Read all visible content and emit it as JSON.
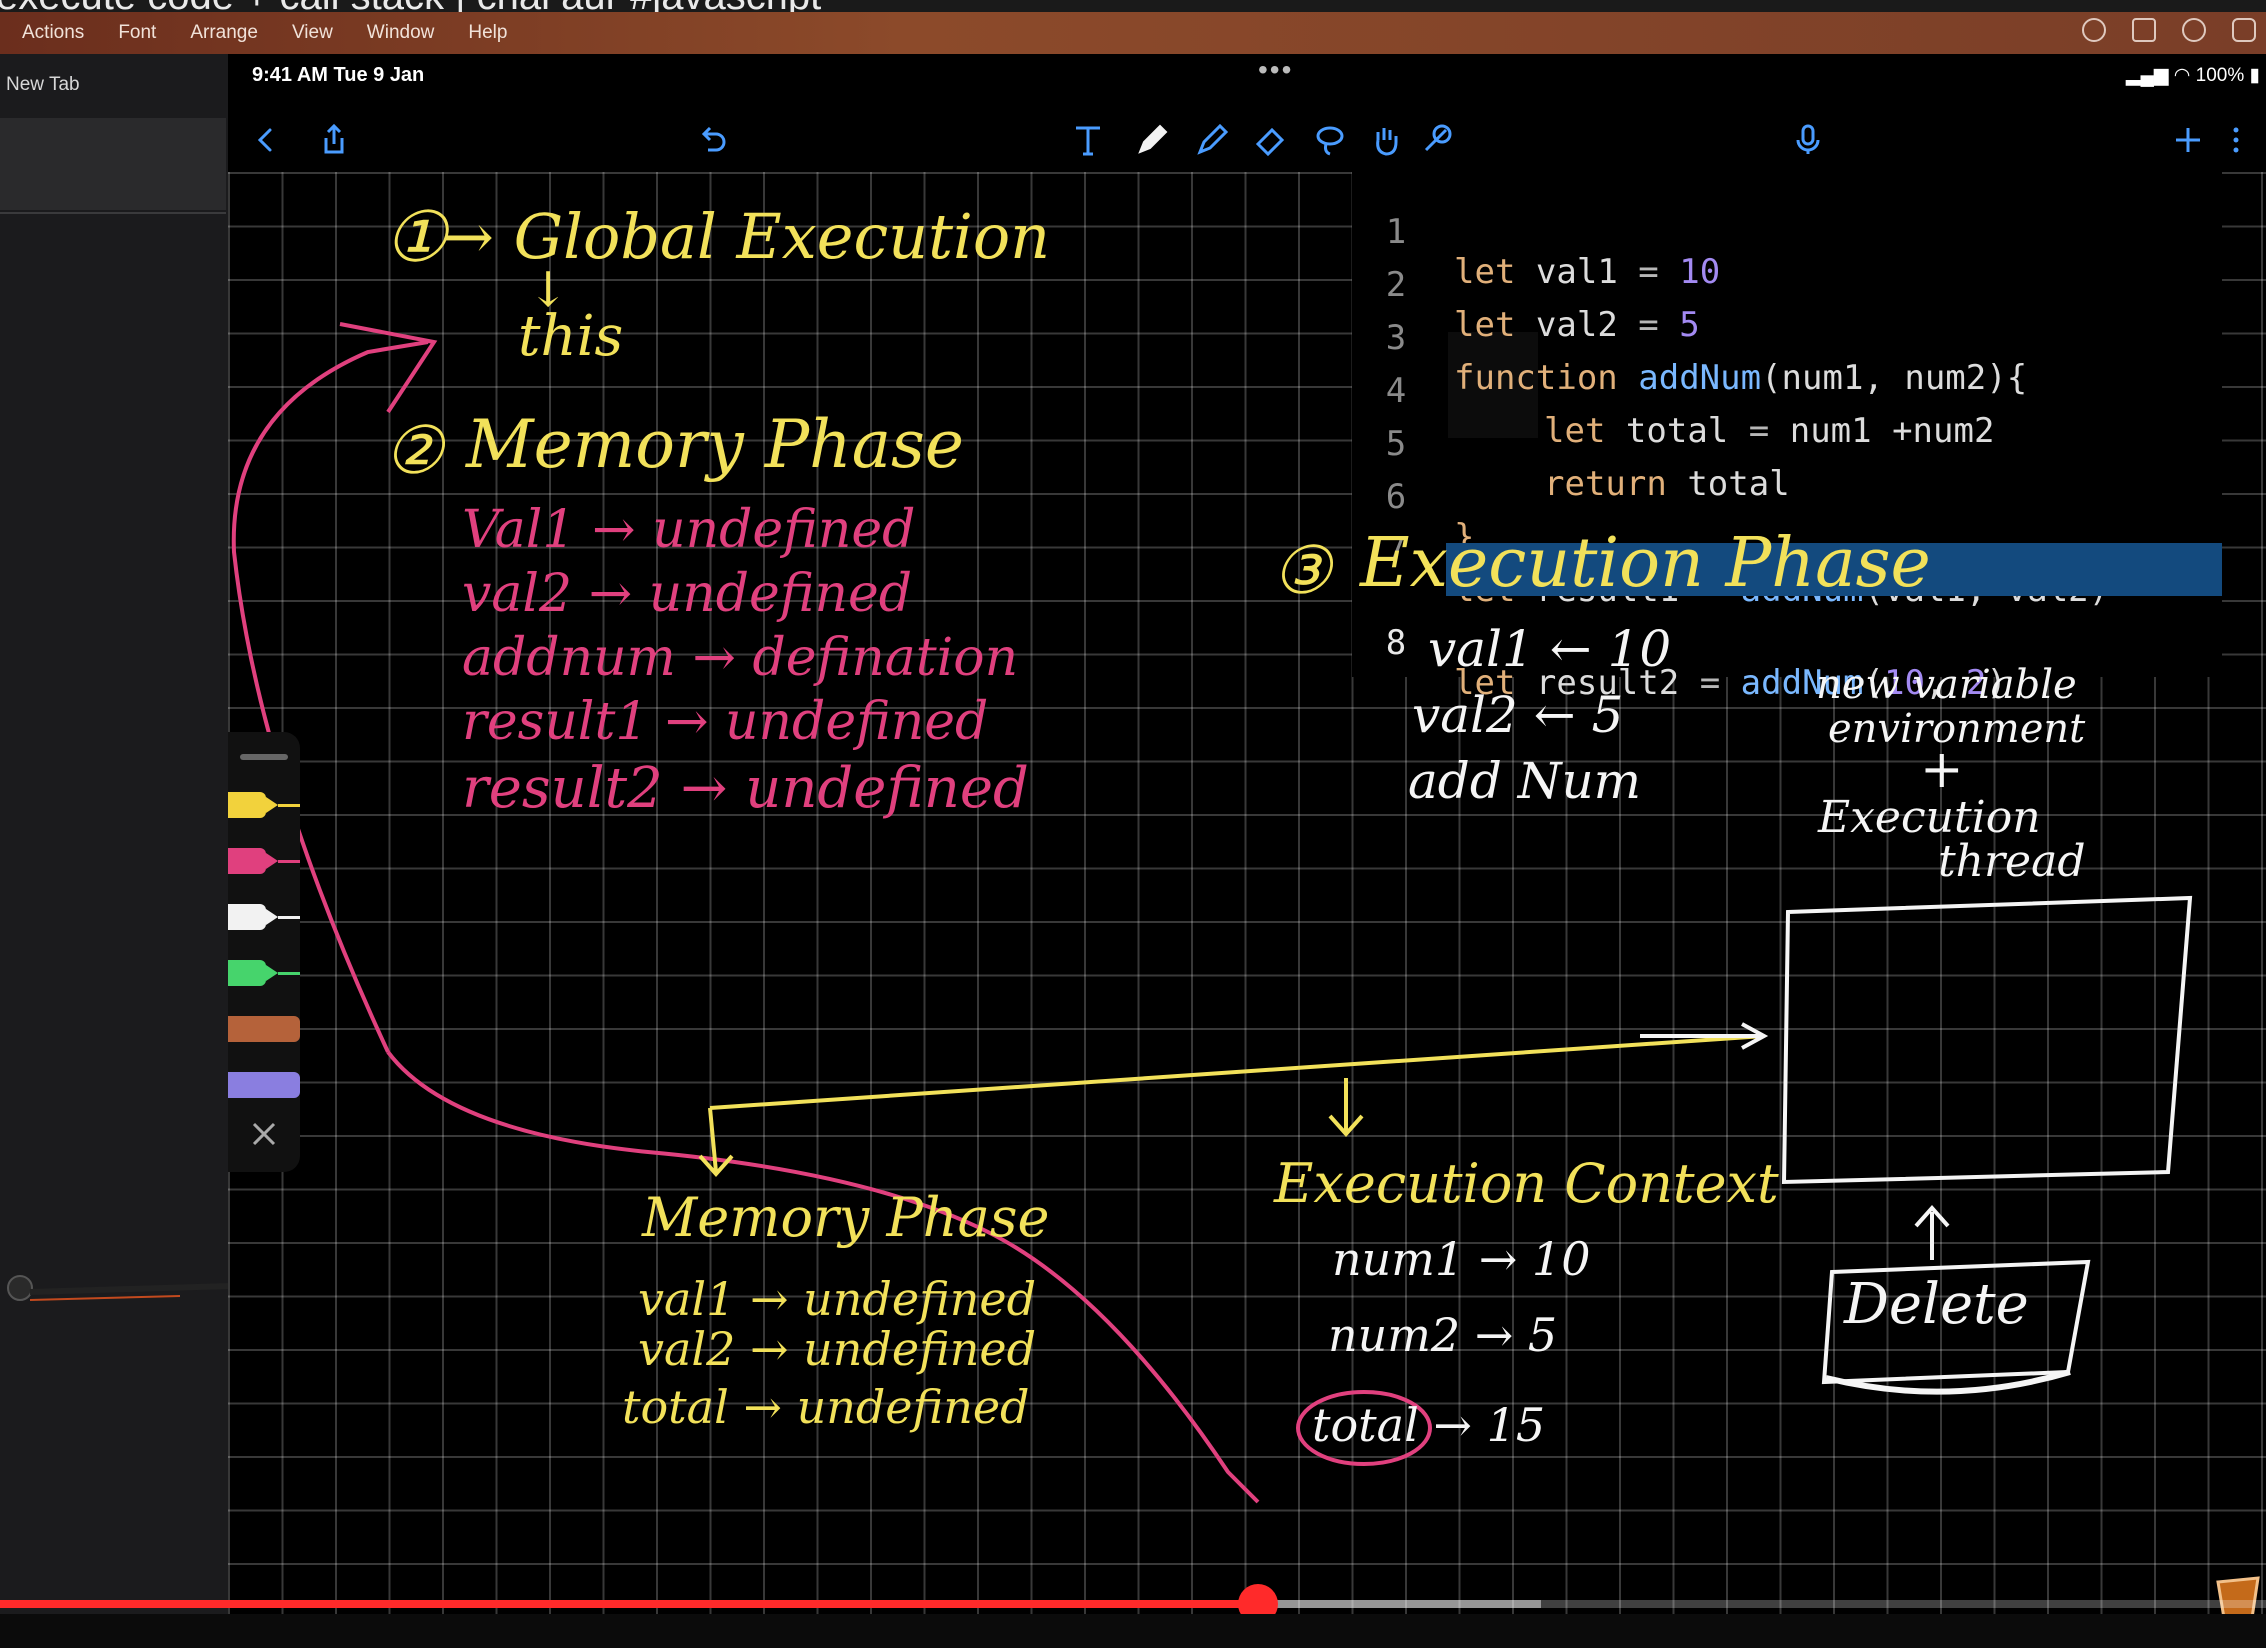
{
  "video": {
    "title_fragment": "execute code + call stack | chai aur #javascript",
    "progress_fraction": 0.555,
    "buffer_fraction": 0.68
  },
  "mac_menu": {
    "items": [
      "Actions",
      "Font",
      "Arrange",
      "View",
      "Window",
      "Help"
    ]
  },
  "sidebar": {
    "new_tab": "New Tab"
  },
  "status_bar": {
    "time": "9:41 AM  Tue 9 Jan",
    "battery": "100%"
  },
  "toolbar": {
    "icons": [
      "back-icon",
      "share-icon",
      "undo-icon",
      "text-tool-icon",
      "pen-tool-icon",
      "highlighter-icon",
      "eraser-icon",
      "lasso-icon",
      "hand-icon",
      "link-icon",
      "microphone-icon",
      "add-icon",
      "more-icon"
    ]
  },
  "code": {
    "lines": [
      {
        "n": "1",
        "text": "let val1 = 10"
      },
      {
        "n": "2",
        "text": "let val2 = 5"
      },
      {
        "n": "3",
        "text": "function addNum(num1, num2){"
      },
      {
        "n": "4",
        "text": "let total = num1 +num2"
      },
      {
        "n": "5",
        "text": "return total"
      },
      {
        "n": "6",
        "text": "}"
      },
      {
        "n": "7",
        "text": "let result1 = addNum(val1, val2)"
      },
      {
        "n": "8",
        "text": "let result2 = addNum(10, 2)"
      }
    ],
    "tokens": {
      "l1": [
        "let",
        "val1",
        "=",
        "10"
      ],
      "l2": [
        "let",
        "val2",
        "=",
        "5"
      ],
      "l3": [
        "function",
        "addNum",
        "(num1, num2){"
      ],
      "l4": [
        "let",
        "total",
        "=",
        "num1 +num2"
      ],
      "l5": [
        "return",
        "total"
      ],
      "l6": [
        "}"
      ],
      "l7": [
        "let",
        "result1",
        "=",
        "addNum",
        "(val1, val2)"
      ],
      "l8": [
        "let",
        "result2",
        "=",
        "addNum",
        "(",
        "10",
        ", ",
        "2",
        ")"
      ]
    },
    "highlighted_line": "8"
  },
  "notes": {
    "step1_num": "①",
    "step1": "→ Global Execution",
    "arrow_down": "↓",
    "this": "this",
    "step2_num": "②",
    "step2": "Memory Phase",
    "memory": [
      "Val1 → undefined",
      "val2 → undefined",
      "addnum → defination",
      "result1 → undefined",
      "result2 → undefined"
    ],
    "step3_num": "③",
    "step3": "Execution Phase",
    "exec": [
      {
        "left": "val1",
        "arrow": "←",
        "right": "10"
      },
      {
        "left": "val2",
        "arrow": "←",
        "right": "5"
      },
      {
        "left": "add Num",
        "arrow": "⟶",
        "right": ""
      }
    ],
    "box": {
      "line1": "new variable",
      "line2": "environment",
      "plus": "+",
      "line3": "Execution",
      "line4": "thread"
    },
    "delete": "Delete",
    "sub_memory_title": "Memory Phase",
    "sub_memory": [
      "val1 → undefined",
      "val2 → undefined",
      "total → undefined"
    ],
    "exec_context_title": "Execution Context",
    "exec_context": [
      "num1 → 10",
      "num2 → 5",
      "total → 15"
    ]
  },
  "colors": {
    "yellow_ink": "#f2e15a",
    "pink_ink": "#e0407e",
    "white_ink": "#f5f5f5",
    "code_highlight": "#134a7e",
    "progress": "#ff2a2a"
  },
  "pens": [
    {
      "name": "yellow-pen",
      "color": "#f2d23c"
    },
    {
      "name": "pink-pen",
      "color": "#e0407e"
    },
    {
      "name": "white-pen",
      "color": "#f2f2f2"
    },
    {
      "name": "green-pen",
      "color": "#46d46c"
    },
    {
      "name": "brown-pen",
      "color": "#b5623a"
    },
    {
      "name": "lavender-pen",
      "color": "#8a7ee0"
    }
  ]
}
